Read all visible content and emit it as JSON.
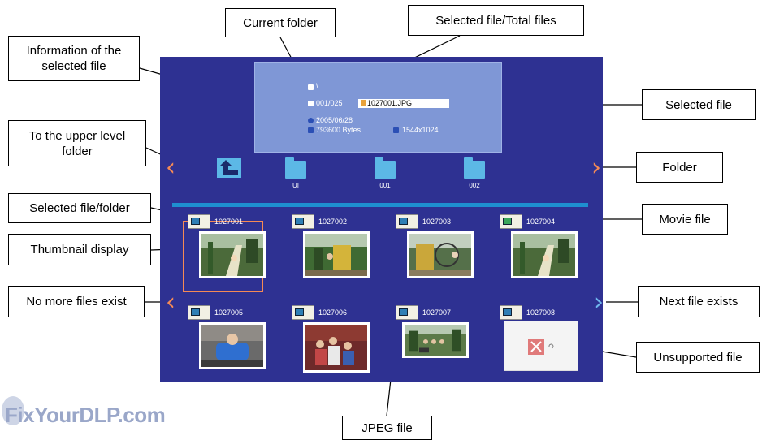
{
  "callouts": {
    "current_folder": "Current folder",
    "selected_total": "Selected file/Total files",
    "info_line1": "Information of the",
    "info_line2": "selected file",
    "selected_file": "Selected file",
    "upper_line1": "To the upper level",
    "upper_line2": "folder",
    "folder": "Folder",
    "selected_file_folder": "Selected file/folder",
    "movie_file": "Movie file",
    "thumbnail_display": "Thumbnail display",
    "no_more_files": "No more files exist",
    "next_file_exists": "Next file exists",
    "unsupported_file": "Unsupported file",
    "jpeg_file": "JPEG file"
  },
  "info_panel": {
    "path": "\\",
    "counter": "001/025",
    "filename": "1027001.JPG",
    "date": "2005/06/28",
    "size": "793600 Bytes",
    "resolution": "1544x1024"
  },
  "folders": [
    {
      "label": "UI"
    },
    {
      "label": "001"
    },
    {
      "label": "002"
    }
  ],
  "files": [
    {
      "number": "1027001",
      "kind": "jpeg"
    },
    {
      "number": "1027002",
      "kind": "jpeg"
    },
    {
      "number": "1027003",
      "kind": "jpeg"
    },
    {
      "number": "1027004",
      "kind": "movie"
    },
    {
      "number": "1027005",
      "kind": "jpeg"
    },
    {
      "number": "1027006",
      "kind": "jpeg"
    },
    {
      "number": "1027007",
      "kind": "jpeg"
    },
    {
      "number": "1027008",
      "kind": "unsupported"
    }
  ],
  "arrows": {
    "folder_left": "‹",
    "folder_right": "›",
    "file_left": "‹",
    "file_right": "›"
  },
  "colors": {
    "screen_bg": "#2e3192",
    "info_panel_bg": "#7f97d6",
    "folder_blue": "#5cb8e6",
    "arrow_orange": "#f58a55",
    "arrow_blue": "#6fb7ee",
    "divider": "#1e8fd0"
  },
  "watermark": "FixYourDLP.com"
}
